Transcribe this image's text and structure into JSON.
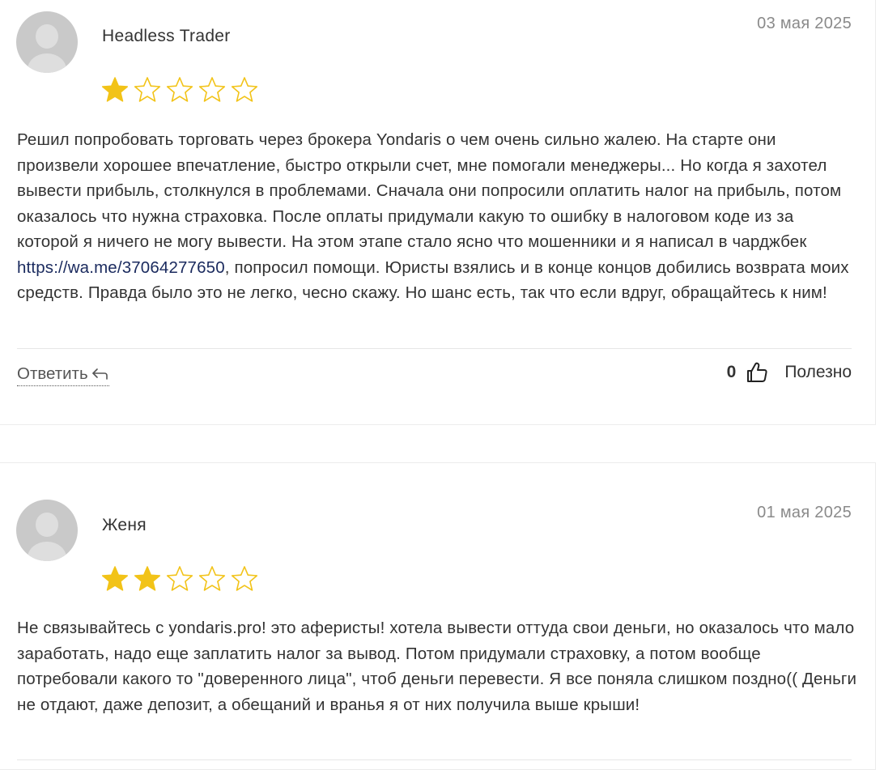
{
  "reviews": [
    {
      "author": "Headless Trader",
      "date": "03 мая 2025",
      "rating": 1,
      "rating_max": 5,
      "text_before_link": "Решил попробовать торговать через брокера Yondaris о чем очень сильно жалею. На старте они произвели хорошее впечатление, быстро открыли счет, мне помогали менеджеры... Но когда я захотел вывести прибыль, столкнулся в проблемами. Сначала они попросили оплатить налог на прибыль, потом оказалось что нужна страховка. После оплаты придумали какую то ошибку в налоговом коде из за которой я ничего не могу вывести. На этом этапе стало ясно что мошенники и я написал в чарджбек ",
      "link_text": "https://wa.me/37064277650",
      "text_after_link": ", попросил помощи. Юристы взялись и в конце концов добились возврата моих средств. Правда было это не легко, чесно скажу. Но шанс есть, так что если вдруг, обращайтесь к ним!",
      "reply_label": "Ответить",
      "helpful_count": "0",
      "helpful_label": "Полезно"
    },
    {
      "author": "Женя",
      "date": "01 мая 2025",
      "rating": 2,
      "rating_max": 5,
      "text": "Не связывайтесь с yondaris.pro! это аферисты! хотела вывести оттуда свои деньги, но оказалось что мало заработать, надо еще заплатить налог за вывод. Потом придумали страховку, а потом вообще потребовали какого то \"доверенного лица\", чтоб деньги перевести. Я все поняла слишком поздно(( Деньги не отдают, даже депозит, а обещаний и вранья я от них получила выше крыши!"
    }
  ],
  "colors": {
    "star_filled": "#f2c318",
    "star_empty_stroke": "#f2c318",
    "link": "#1a2a5e",
    "date": "#8a8a8a"
  },
  "icons": {
    "avatar": "user-placeholder-icon",
    "star": "star-icon",
    "reply": "reply-arrow-icon",
    "helpful": "thumbs-up-icon"
  }
}
